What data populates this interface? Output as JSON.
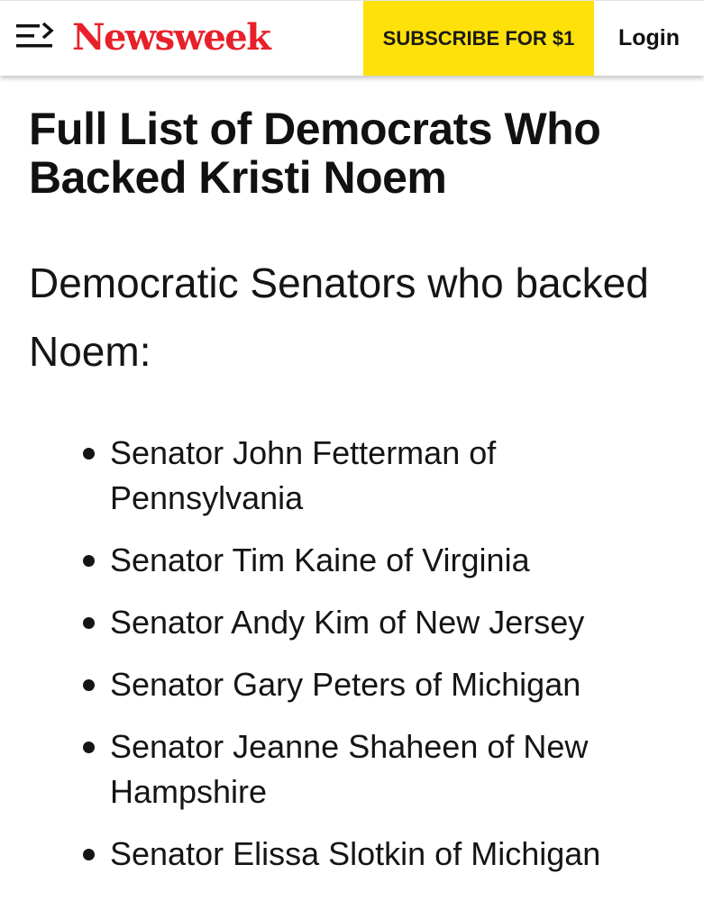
{
  "header": {
    "logo_text": "Newsweek",
    "subscribe_label": "SUBSCRIBE FOR $1",
    "login_label": "Login",
    "menu_icon": "menu-icon",
    "colors": {
      "logo": "#e8202a",
      "subscribe_bg": "#ffe10a"
    }
  },
  "article": {
    "headline": "Full List of Democrats Who Backed Kristi Noem",
    "subheading": "Democratic Senators who backed Noem:",
    "items": [
      {
        "text": "Senator John Fetterman of Pennsylvania"
      },
      {
        "text": "Senator Tim Kaine of Virginia"
      },
      {
        "text": "Senator Andy Kim of New Jersey"
      },
      {
        "text": "Senator Gary Peters of Michigan"
      },
      {
        "text": "Senator Jeanne Shaheen of New Hampshire"
      },
      {
        "text": "Senator Elissa Slotkin of Michigan"
      }
    ]
  }
}
